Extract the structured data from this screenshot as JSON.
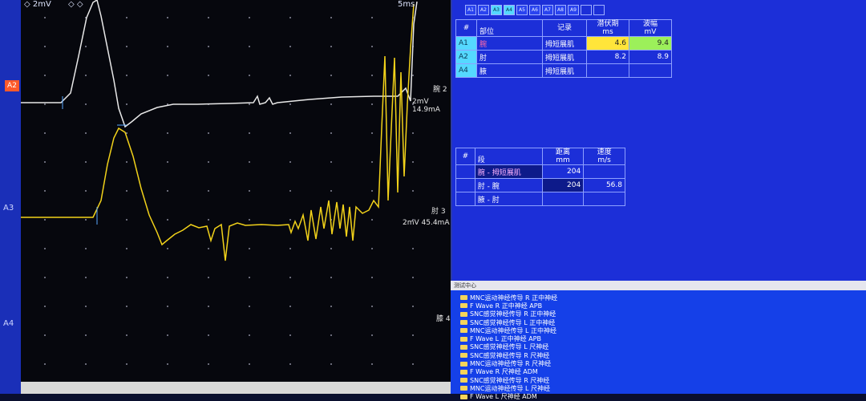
{
  "plot": {
    "scale_top": "2mV",
    "scale_top_right": "5ms",
    "channels": {
      "a2_badge": "A2",
      "a3": "A3",
      "a4": "A4"
    },
    "trace_labels": {
      "ch2_name": "腕 2",
      "ch2_scale": "2mV 14.9mA",
      "ch3_name": "肘 3",
      "ch3_scale": "2mV 45.4mA",
      "ch4_name": "膝 4"
    },
    "trace_colors": {
      "ch2": "#e8e8e8",
      "ch3": "#f2d21a"
    }
  },
  "tabs": [
    "A1",
    "A2",
    "A3",
    "A4",
    "A5",
    "A6",
    "A7",
    "A8",
    "A9",
    "",
    ""
  ],
  "latency_table": {
    "headers": {
      "index": "#",
      "site": "部位",
      "record": "记录",
      "latency": "潜伏期",
      "latency_unit": "ms",
      "amp": "波幅",
      "amp_unit": "mV"
    },
    "rows": [
      {
        "idx": "A1",
        "site": "腕",
        "record": "拇短展肌",
        "latency": "4.6",
        "amp": "9.4"
      },
      {
        "idx": "A2",
        "site": "肘",
        "record": "拇短展肌",
        "latency": "8.2",
        "amp": "8.9"
      },
      {
        "idx": "A4",
        "site": "腋",
        "record": "拇短展肌",
        "latency": "",
        "amp": ""
      }
    ]
  },
  "velocity_table": {
    "headers": {
      "index": "#",
      "segment": "段",
      "distance": "距离",
      "distance_unit": "mm",
      "speed": "速度",
      "speed_unit": "m/s"
    },
    "rows": [
      {
        "segment": "腕 - 拇短展肌",
        "distance": "204",
        "speed": ""
      },
      {
        "segment": "肘 - 腕",
        "distance": "204",
        "speed": "56.8"
      },
      {
        "segment": "腋 - 肘",
        "distance": "",
        "speed": ""
      }
    ]
  },
  "tree": {
    "header": "测试中心",
    "items": [
      "MNC运动神经传导 R 正中神经",
      "F Wave R 正中神经 APB",
      "SNC感觉神经传导 R 正中神经",
      "SNC感觉神经传导 L 正中神经",
      "MNC运动神经传导 L 正中神经",
      "F Wave L 正中神经 APB",
      "SNC感觉神经传导 L 尺神经",
      "SNC感觉神经传导 R 尺神经",
      "MNC运动神经传导 R 尺神经",
      "F Wave R 尺神经 ADM",
      "SNC感觉神经传导 R 尺神经",
      "MNC运动神经传导 L 尺神经",
      "F Wave L 尺神经 ADM"
    ]
  }
}
